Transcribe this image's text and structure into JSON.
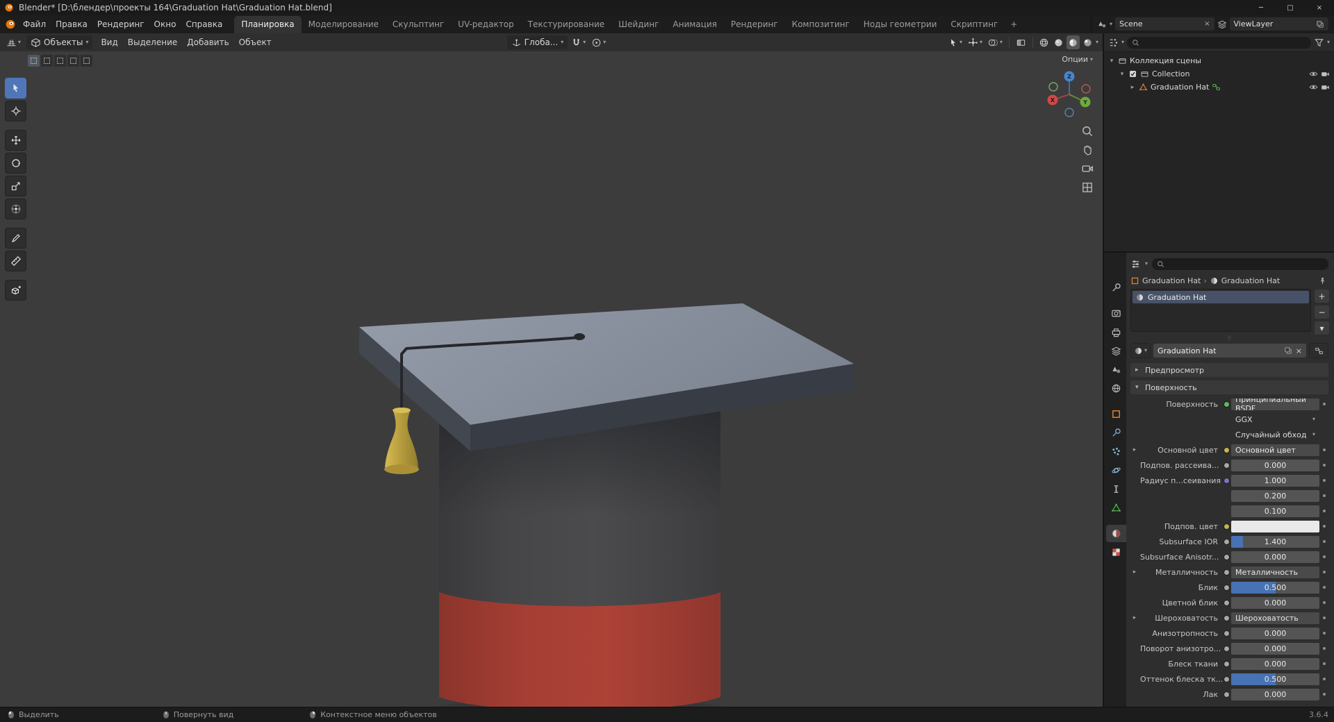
{
  "icons": {
    "chevron_down": "▾",
    "expand_open": "▾",
    "expand_closed": "▸",
    "plus": "+",
    "minus": "−",
    "specials": "▾",
    "close": "×",
    "window_minimize": "─",
    "window_maximize": "□",
    "breadcrumb_separator": "›",
    "grip": "⠿"
  },
  "titlebar": {
    "title": "Blender* [D:\\блендер\\проекты 164\\Graduation Hat\\Graduation Hat.blend]"
  },
  "topbar": {
    "menus": [
      "Файл",
      "Правка",
      "Рендеринг",
      "Окно",
      "Справка"
    ],
    "workspaces": [
      {
        "label": "Планировка",
        "active": true
      },
      {
        "label": "Моделирование",
        "active": false
      },
      {
        "label": "Скульптинг",
        "active": false
      },
      {
        "label": "UV-редактор",
        "active": false
      },
      {
        "label": "Текстурирование",
        "active": false
      },
      {
        "label": "Шейдинг",
        "active": false
      },
      {
        "label": "Анимация",
        "active": false
      },
      {
        "label": "Рендеринг",
        "active": false
      },
      {
        "label": "Композитинг",
        "active": false
      },
      {
        "label": "Ноды геометрии",
        "active": false
      },
      {
        "label": "Скриптинг",
        "active": false
      }
    ],
    "add_workspace": "+",
    "scene": "Scene",
    "viewlayer": "ViewLayer"
  },
  "viewport": {
    "header": {
      "mode": "Объекты",
      "menus": [
        "Вид",
        "Выделение",
        "Добавить",
        "Объект"
      ],
      "orientation": "Глоба..."
    },
    "options": "Опции",
    "gizmo": {
      "x": "X",
      "y": "Y",
      "z": "Z"
    },
    "tools": [
      {
        "name": "tweak-box-select",
        "active": true
      },
      {
        "name": "cursor",
        "active": false
      },
      {
        "name": "move",
        "active": false,
        "gap": true
      },
      {
        "name": "rotate",
        "active": false
      },
      {
        "name": "scale",
        "active": false
      },
      {
        "name": "transform",
        "active": false
      },
      {
        "name": "annotate",
        "active": false,
        "gap": true
      },
      {
        "name": "measure",
        "active": false
      },
      {
        "name": "add-cube",
        "active": false,
        "gap": true
      }
    ],
    "select_modes": [
      {
        "name": "set",
        "active": true
      },
      {
        "name": "extend",
        "active": false
      },
      {
        "name": "subtract",
        "active": false
      },
      {
        "name": "invert",
        "active": false
      },
      {
        "name": "intersect",
        "active": false
      }
    ]
  },
  "outliner": {
    "rows": [
      {
        "label": "Коллекция сцены",
        "level": 0,
        "disclosure": "open",
        "icon": "collection",
        "checkbox": false,
        "extra": "",
        "toggles": []
      },
      {
        "label": "Collection",
        "level": 1,
        "disclosure": "open",
        "icon": "collection",
        "checkbox": true,
        "extra": "",
        "toggles": [
          "eye",
          "camera"
        ]
      },
      {
        "label": "Graduation Hat",
        "level": 2,
        "disclosure": "closed",
        "icon": "mesh",
        "checkbox": false,
        "extra": "nodes",
        "toggles": [
          "eye",
          "camera"
        ]
      }
    ]
  },
  "properties": {
    "tabs": [
      {
        "name": "tool",
        "active": false
      },
      {
        "name": "render",
        "active": false,
        "group": true
      },
      {
        "name": "output",
        "active": false
      },
      {
        "name": "view-layer",
        "active": false
      },
      {
        "name": "scene",
        "active": false
      },
      {
        "name": "world",
        "active": false
      },
      {
        "name": "object",
        "active": false,
        "group": true
      },
      {
        "name": "modifiers",
        "active": false
      },
      {
        "name": "particles",
        "active": false
      },
      {
        "name": "physics",
        "active": false
      },
      {
        "name": "constraints",
        "active": false
      },
      {
        "name": "data",
        "active": false
      },
      {
        "name": "material",
        "active": true,
        "group": true
      },
      {
        "name": "texture",
        "active": false
      }
    ],
    "breadcrumb": {
      "object": "Graduation Hat",
      "data": "Graduation Hat"
    },
    "slots": [
      {
        "name": "Graduation Hat",
        "selected": true
      }
    ],
    "material_name": "Graduation Hat",
    "preview_section": "Предпросмотр",
    "surface_section": "Поверхность",
    "rows": [
      {
        "label": "Поверхность",
        "value": "Принципиальный BSDF",
        "type": "link",
        "socket": "shader"
      },
      {
        "label": "",
        "value": "GGX",
        "type": "dropdown"
      },
      {
        "label": "",
        "value": "Случайный обход",
        "type": "dropdown"
      },
      {
        "label": "Основной цвет",
        "value": "Основной цвет",
        "type": "link",
        "socket": "color",
        "expand": true
      },
      {
        "label": "Подпов. рассеива...",
        "value": "0.000",
        "type": "number",
        "socket": "value"
      },
      {
        "label": "Радиус п...сеивания",
        "value": "1.000",
        "type": "number",
        "socket": "vector"
      },
      {
        "label": "",
        "value": "0.200",
        "type": "number"
      },
      {
        "label": "",
        "value": "0.100",
        "type": "number"
      },
      {
        "label": "Подпов. цвет",
        "value": "",
        "type": "color",
        "swatch": "#e9e9e9",
        "socket": "color"
      },
      {
        "label": "Subsurface IOR",
        "value": "1.400",
        "type": "slider",
        "fill": 0.13,
        "socket": "value"
      },
      {
        "label": "Subsurface Anisotr...",
        "value": "0.000",
        "type": "number",
        "socket": "value"
      },
      {
        "label": "Металличность",
        "value": "Металличность",
        "type": "link",
        "socket": "value",
        "expand": true
      },
      {
        "label": "Блик",
        "value": "0.500",
        "type": "slider",
        "fill": 0.5,
        "socket": "value"
      },
      {
        "label": "Цветной блик",
        "value": "0.000",
        "type": "number",
        "socket": "value"
      },
      {
        "label": "Шероховатость",
        "value": "Шероховатость",
        "type": "link",
        "socket": "value",
        "expand": true
      },
      {
        "label": "Анизотропность",
        "value": "0.000",
        "type": "number",
        "socket": "value"
      },
      {
        "label": "Поворот анизотро...",
        "value": "0.000",
        "type": "number",
        "socket": "value"
      },
      {
        "label": "Блеск ткани",
        "value": "0.000",
        "type": "number",
        "socket": "value"
      },
      {
        "label": "Оттенок блеска тк...",
        "value": "0.500",
        "type": "slider",
        "fill": 0.5,
        "socket": "value"
      },
      {
        "label": "Лак",
        "value": "0.000",
        "type": "number",
        "socket": "value"
      }
    ]
  },
  "statusbar": {
    "hints": [
      {
        "label": "Выделить",
        "mouse": "left"
      },
      {
        "label": "Повернуть вид",
        "mouse": "middle"
      },
      {
        "label": "Контекстное меню объектов",
        "mouse": "right"
      }
    ],
    "version": "3.6.4"
  },
  "colors": {
    "accent": "#4772b3",
    "object_orange": "#e8872b",
    "data_green": "#55b84e",
    "red_band": "#a53e34",
    "tassel_yellow": "#c9ab3f",
    "board_top": "#8a90a0"
  }
}
